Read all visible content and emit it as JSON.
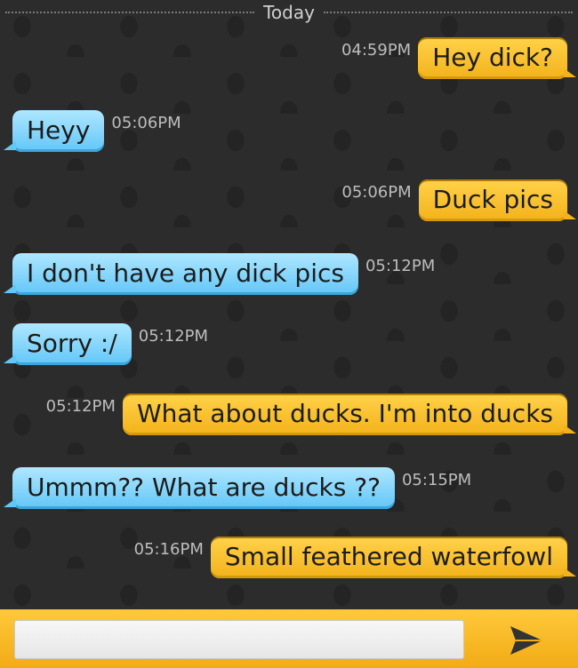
{
  "divider": {
    "label": "Today"
  },
  "messages": [
    {
      "side": "out",
      "time": "04:59PM",
      "text": "Hey dick?"
    },
    {
      "side": "in",
      "time": "05:06PM",
      "text": "Heyy"
    },
    {
      "side": "out",
      "time": "05:06PM",
      "text": "Duck pics"
    },
    {
      "side": "in",
      "time": "05:12PM",
      "text": "I don't have any dick pics"
    },
    {
      "side": "in",
      "time": "05:12PM",
      "text": "Sorry :/"
    },
    {
      "side": "out",
      "time": "05:12PM",
      "text": "What about ducks. I'm into ducks"
    },
    {
      "side": "in",
      "time": "05:15PM",
      "text": "Ummm?? What are ducks ??"
    },
    {
      "side": "out",
      "time": "05:16PM",
      "text": "Small feathered waterfowl"
    }
  ],
  "composer": {
    "input_value": "",
    "send_icon": "send-arrow-icon"
  },
  "colors": {
    "outgoing": "#f3b21a",
    "incoming": "#62c6f7",
    "background": "#2c2c2c"
  }
}
